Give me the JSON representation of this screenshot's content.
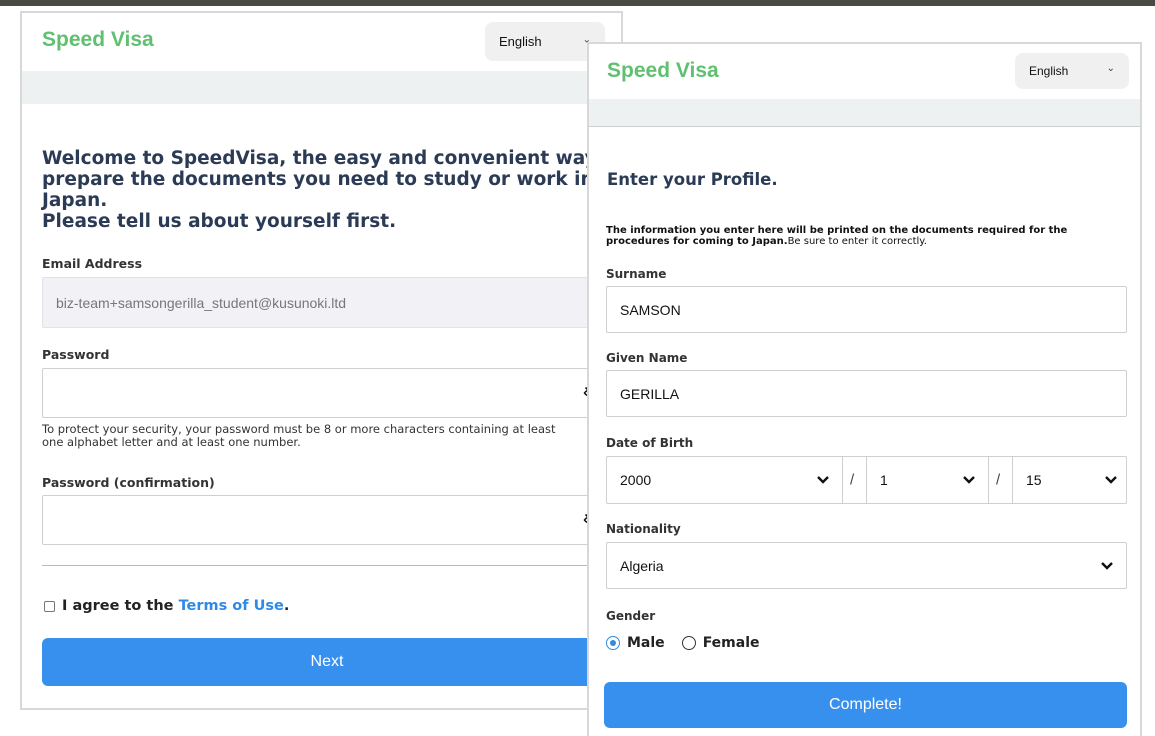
{
  "left_panel": {
    "logo": "Speed Visa",
    "language": "English",
    "welcome_line1": "Welcome to SpeedVisa, the easy and convenient way to",
    "welcome_line2": "prepare the documents you need to study or work in Japan.",
    "welcome_line3": "Please tell us about yourself first.",
    "email_label": "Email Address",
    "email_value": "biz-team+samsongerilla_student@kusunoki.ltd",
    "password_label": "Password",
    "password_help_line1": "To protect your security, your password must be 8 or more characters containing at least",
    "password_help_line2": "one alphabet letter and at least one number.",
    "password_confirm_label": "Password (confirmation)",
    "agree_prefix": "I agree to the ",
    "terms_link": "Terms of Use",
    "agree_suffix": ".",
    "next_button": "Next"
  },
  "right_panel": {
    "logo": "Speed Visa",
    "language": "English",
    "title": "Enter your Profile.",
    "info_bold": "The information you enter here will be printed on the documents required for the procedures for coming to Japan.",
    "info_normal": "Be sure to enter it correctly.",
    "surname_label": "Surname",
    "surname_value": "SAMSON",
    "given_name_label": "Given Name",
    "given_name_value": "GERILLA",
    "dob_label": "Date of Birth",
    "dob_year": "2000",
    "dob_month": "1",
    "dob_day": "15",
    "dob_separator": "/",
    "nationality_label": "Nationality",
    "nationality_value": "Algeria",
    "gender_label": "Gender",
    "gender_male": "Male",
    "gender_female": "Female",
    "gender_selected": "Male",
    "complete_button": "Complete!"
  },
  "colors": {
    "brand_green": "#5fc06f",
    "primary_blue": "#3790ee",
    "heading_navy": "#2b3b55"
  },
  "icons": {
    "password_toggle": "eye-slash-icon",
    "dropdown": "chevron-down-icon"
  }
}
